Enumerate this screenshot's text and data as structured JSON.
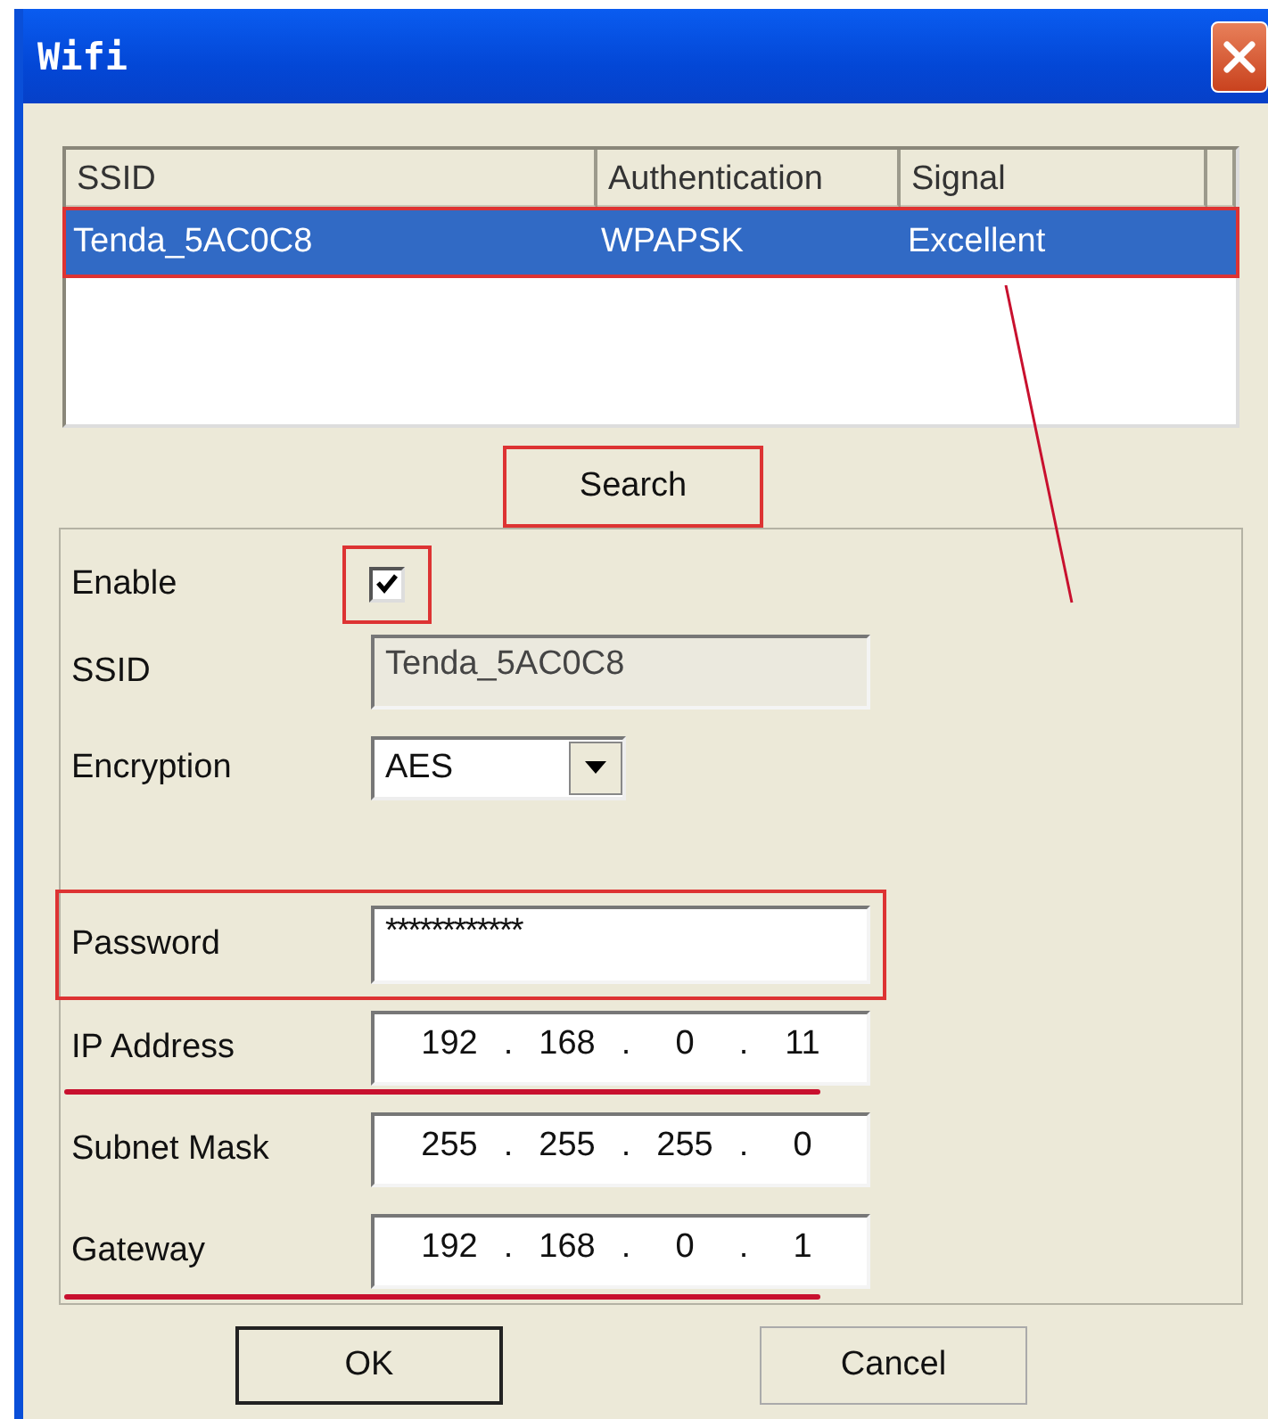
{
  "window": {
    "title": "Wifi"
  },
  "network_list": {
    "columns": [
      "SSID",
      "Authentication",
      "Signal"
    ],
    "rows": [
      {
        "cells": [
          "Tenda_5AC0C8",
          "WPAPSK",
          "Excellent"
        ],
        "selected": true,
        "marked": true
      }
    ]
  },
  "search_button": {
    "label": "Search",
    "marked": true
  },
  "form": {
    "enable": {
      "label": "Enable",
      "checked": true,
      "marked": true
    },
    "ssid": {
      "label": "SSID",
      "value": "Tenda_5AC0C8",
      "disabled": true
    },
    "encryption": {
      "label": "Encryption",
      "value": "AES"
    },
    "password": {
      "label": "Password",
      "value": "************",
      "marked": true
    },
    "address_fields": [
      {
        "label": "IP Address",
        "parts": [
          "192",
          ".",
          "168",
          ".",
          "0",
          ".",
          "11"
        ],
        "underlined": true
      },
      {
        "label": "Subnet Mask",
        "parts": [
          "255",
          ".",
          "255",
          ".",
          "255",
          ".",
          "0"
        ],
        "underlined": false
      },
      {
        "label": "Gateway",
        "parts": [
          "192",
          ".",
          "168",
          ".",
          "0",
          ".",
          "1"
        ],
        "underlined": true
      }
    ]
  },
  "buttons": [
    {
      "label": "OK",
      "default": true
    },
    {
      "label": "Cancel",
      "default": false
    }
  ]
}
